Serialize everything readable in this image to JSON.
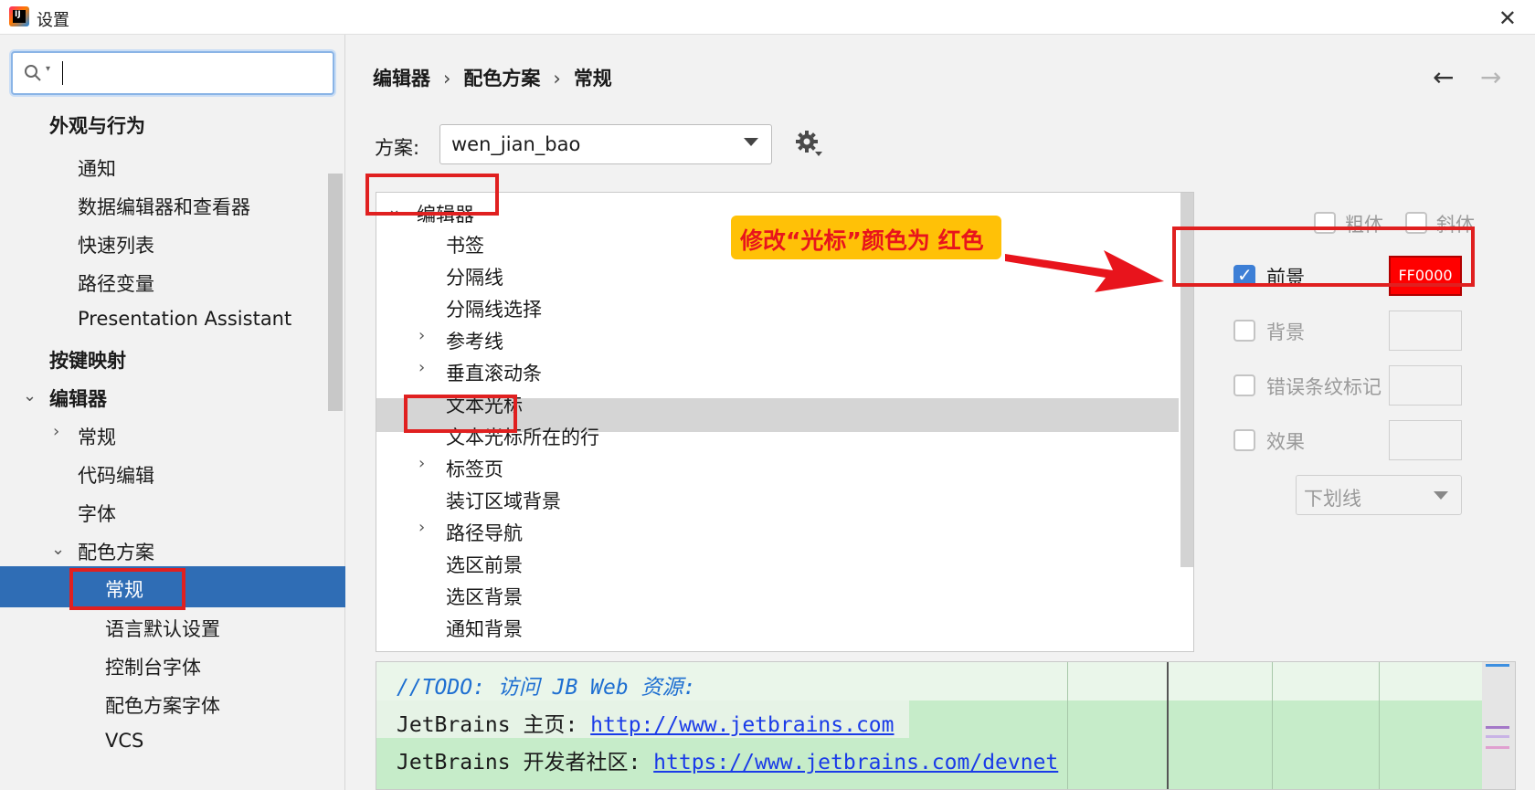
{
  "window": {
    "title": "设置",
    "close_glyph": "✕"
  },
  "search": {
    "placeholder": ""
  },
  "sidebar": {
    "items": [
      {
        "label": "外观与行为"
      },
      {
        "label": "通知"
      },
      {
        "label": "数据编辑器和查看器"
      },
      {
        "label": "快速列表"
      },
      {
        "label": "路径变量"
      },
      {
        "label": "Presentation Assistant"
      },
      {
        "label": "按键映射"
      },
      {
        "label": "编辑器"
      },
      {
        "label": "常规"
      },
      {
        "label": "代码编辑"
      },
      {
        "label": "字体"
      },
      {
        "label": "配色方案"
      },
      {
        "label": "常规"
      },
      {
        "label": "语言默认设置"
      },
      {
        "label": "控制台字体"
      },
      {
        "label": "配色方案字体"
      },
      {
        "label": "VCS"
      }
    ]
  },
  "breadcrumb": {
    "items": [
      "编辑器",
      "配色方案",
      "常规"
    ],
    "separator": "›"
  },
  "nav": {
    "back": "←",
    "forward": "→"
  },
  "scheme": {
    "label": "方案:",
    "value": "wen_jian_bao"
  },
  "tree": {
    "items": [
      {
        "label": "编辑器"
      },
      {
        "label": "书签"
      },
      {
        "label": "分隔线"
      },
      {
        "label": "分隔线选择"
      },
      {
        "label": "参考线"
      },
      {
        "label": "垂直滚动条"
      },
      {
        "label": "文本光标"
      },
      {
        "label": "文本光标所在的行"
      },
      {
        "label": "标签页"
      },
      {
        "label": "装订区域背景"
      },
      {
        "label": "路径导航"
      },
      {
        "label": "选区前景"
      },
      {
        "label": "选区背景"
      },
      {
        "label": "通知背景"
      }
    ]
  },
  "annotation": {
    "text": "修改“光标”颜色为 红色",
    "color": "#e8141c",
    "bg": "#ffc107"
  },
  "props": {
    "bold": "粗体",
    "italic": "斜体",
    "foreground": {
      "label": "前景",
      "checked": true,
      "value": "FF0000",
      "color": "#ff0000"
    },
    "background": {
      "label": "背景",
      "checked": false
    },
    "error_stripe": {
      "label": "错误条纹标记",
      "checked": false
    },
    "effects": {
      "label": "效果",
      "checked": false
    },
    "effect_type": "下划线"
  },
  "preview": {
    "todo": "//TODO: 访问 JB Web 资源:",
    "line1_prefix": "JetBrains 主页: ",
    "line1_link": "http://www.jetbrains.com",
    "line2_prefix": "JetBrains 开发者社区: ",
    "line2_link": "https://www.jetbrains.com/devnet"
  },
  "colors": {
    "selection": "#2f6db5",
    "highlight": "#e02020",
    "preview_bg": "#c6ecc9"
  }
}
